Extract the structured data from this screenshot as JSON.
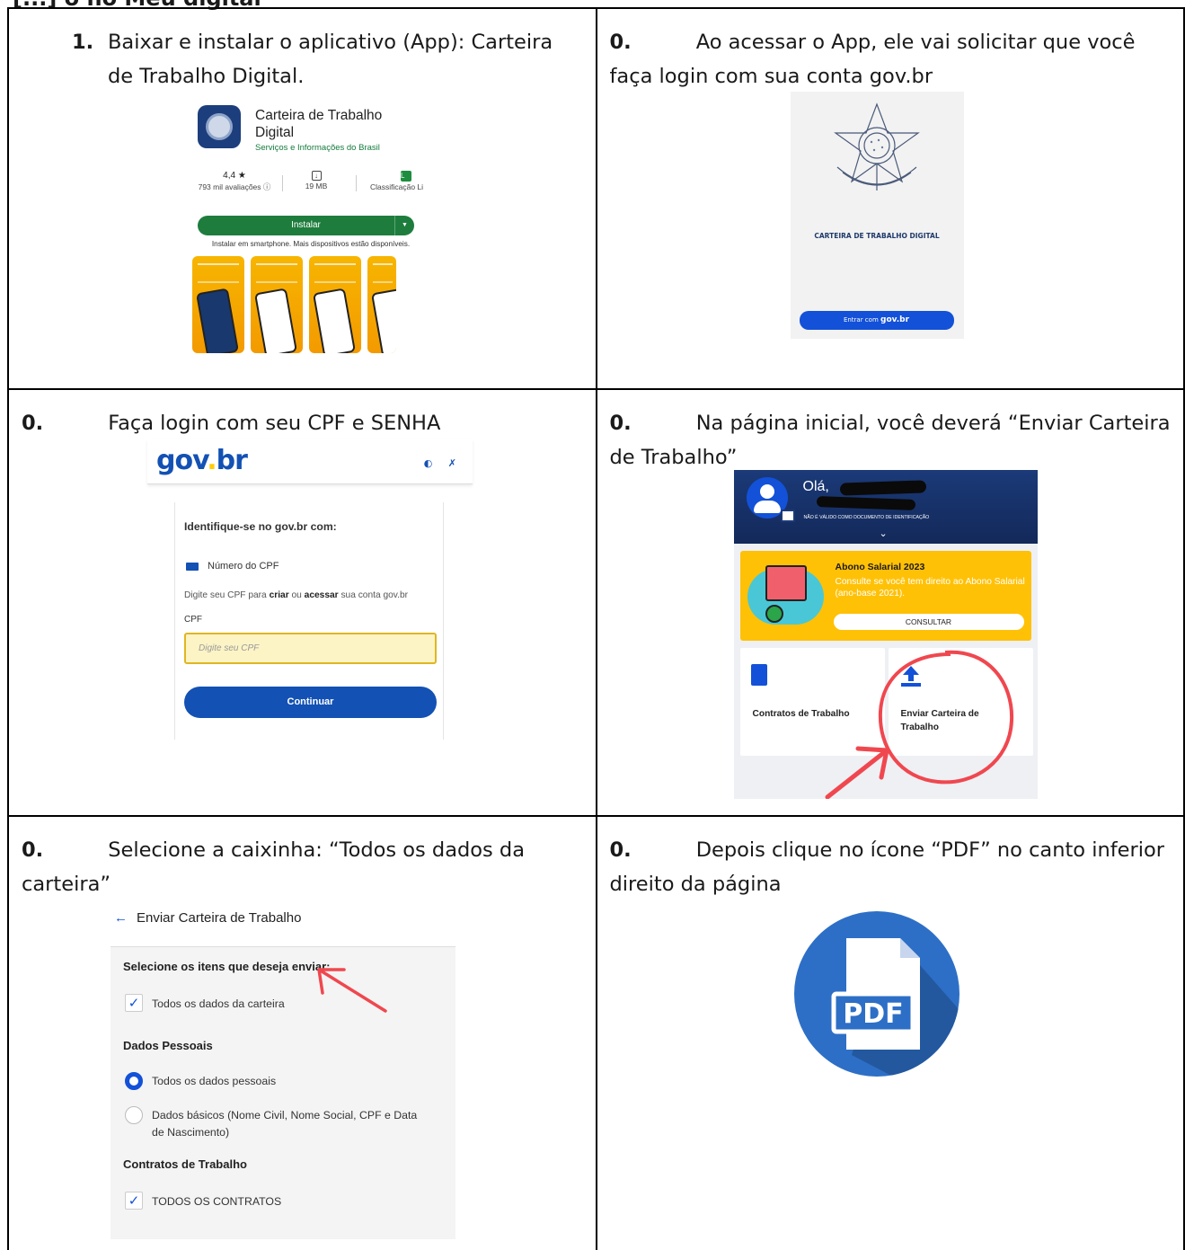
{
  "header": {
    "text": "[...] o no Meu digital"
  },
  "steps": [
    {
      "num": "1.",
      "text": "Baixar e instalar o aplicativo (App): Carteira de Trabalho Digital."
    },
    {
      "num": "0.",
      "text": "Ao acessar o App, ele vai solicitar que você faça login com sua conta gov.br"
    },
    {
      "num": "0.",
      "text": "Faça login com seu CPF e SENHA"
    },
    {
      "num": "0.",
      "text": "Na página inicial, você deverá “Enviar Carteira de Trabalho”"
    },
    {
      "num": "0.",
      "text": "Selecione a caixinha: “Todos os dados da carteira”"
    },
    {
      "num": "0.",
      "text": "Depois clique no ícone “PDF” no canto inferior direito da página"
    }
  ],
  "store": {
    "app_name": "Carteira de Trabalho Digital",
    "publisher": "Serviços e Informações do Brasil",
    "rating": "4,4 ★",
    "reviews": "793 mil avaliações ⓘ",
    "size": "19 MB",
    "classification": "Classificação Li",
    "install_label": "Instalar",
    "install_note": "Instalar em smartphone. Mais dispositivos estão disponíveis."
  },
  "splash": {
    "title": "CARTEIRA DE TRABALHO DIGITAL",
    "button_prefix": "Entrar com",
    "button_brand": "gov.br"
  },
  "govbr": {
    "logo_a": "gov",
    "logo_b": "br",
    "identify": "Identifique-se no gov.br com:",
    "cpf_option": "Número do CPF",
    "hint_a": "Digite seu CPF para ",
    "hint_b": "criar",
    "hint_c": " ou ",
    "hint_d": "acessar",
    "hint_e": " sua conta gov.br",
    "cpf_label": "CPF",
    "cpf_placeholder": "Digite seu CPF",
    "continue": "Continuar"
  },
  "home": {
    "greeting": "Olá,",
    "notice": "NÃO É VÁLIDO COMO DOCUMENTO DE IDENTIFICAÇÃO",
    "abono_title": "Abono Salarial 2023",
    "abono_desc": "Consulte se você tem direito ao Abono Salarial (ano-base 2021).",
    "consult": "CONSULTAR",
    "tile1": "Contratos de Trabalho",
    "tile2": "Enviar Carteira de Trabalho"
  },
  "enviar": {
    "title": "Enviar Carteira de Trabalho",
    "select_heading": "Selecione os itens que deseja enviar:",
    "all_data": "Todos os dados da carteira",
    "personal_heading": "Dados Pessoais",
    "all_personal": "Todos os dados pessoais",
    "basic": "Dados básicos (Nome Civil, Nome Social, CPF e Data de Nascimento)",
    "contracts_heading": "Contratos de Trabalho",
    "all_contracts": "TODOS OS CONTRATOS"
  },
  "pdf": {
    "label": "PDF"
  },
  "colors": {
    "govblue": "#1351b4",
    "accent_red": "#f0474f",
    "pdf_blue": "#2d6fc6"
  }
}
